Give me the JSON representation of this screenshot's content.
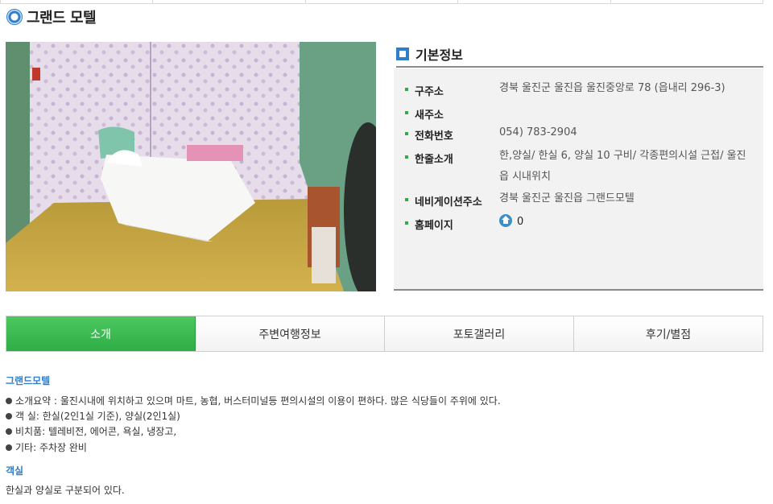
{
  "header": {
    "title": "그랜드 모텔"
  },
  "info": {
    "title": "기본정보",
    "rows": [
      {
        "label": "구주소",
        "value": "경북 울진군 울진읍 울진중앙로 78 (읍내리 296-3)"
      },
      {
        "label": "새주소",
        "value": ""
      },
      {
        "label": "전화번호",
        "value": "054) 783-2904"
      },
      {
        "label": "한줄소개",
        "value": "한,양실/ 한실 6, 양실 10 구비/ 각종편의시설 근접/ 울진읍 시내위치"
      },
      {
        "label": "네비게이션주소",
        "value": "경북 울진군 울진읍 그랜드모텔"
      },
      {
        "label": "홈페이지",
        "value": "0"
      }
    ]
  },
  "tabs": [
    {
      "label": "소개",
      "active": true
    },
    {
      "label": "주변여행정보",
      "active": false
    },
    {
      "label": "포토갤러리",
      "active": false
    },
    {
      "label": "후기/별점",
      "active": false
    }
  ],
  "intro": {
    "title": "그랜드모텔",
    "items": [
      "소개요약 : 울진시내에 위치하고 있으며 마트, 농협, 버스터미널등 편의시설의 이용이 편하다. 많은 식당들이 주위에 있다.",
      "객 실: 한실(2인1실 기준), 양실(2인1실)",
      "비치품: 텔레비전, 에어콘, 욕실, 냉장고,",
      "기타: 주차장 완비"
    ]
  },
  "rooms": {
    "title": "객실",
    "text": "한실과 양실로 구분되어 있다."
  },
  "colors": {
    "accent_blue": "#2f7ec9",
    "tab_active_green": "#3dbb52",
    "bullet_green": "#33a84b"
  }
}
